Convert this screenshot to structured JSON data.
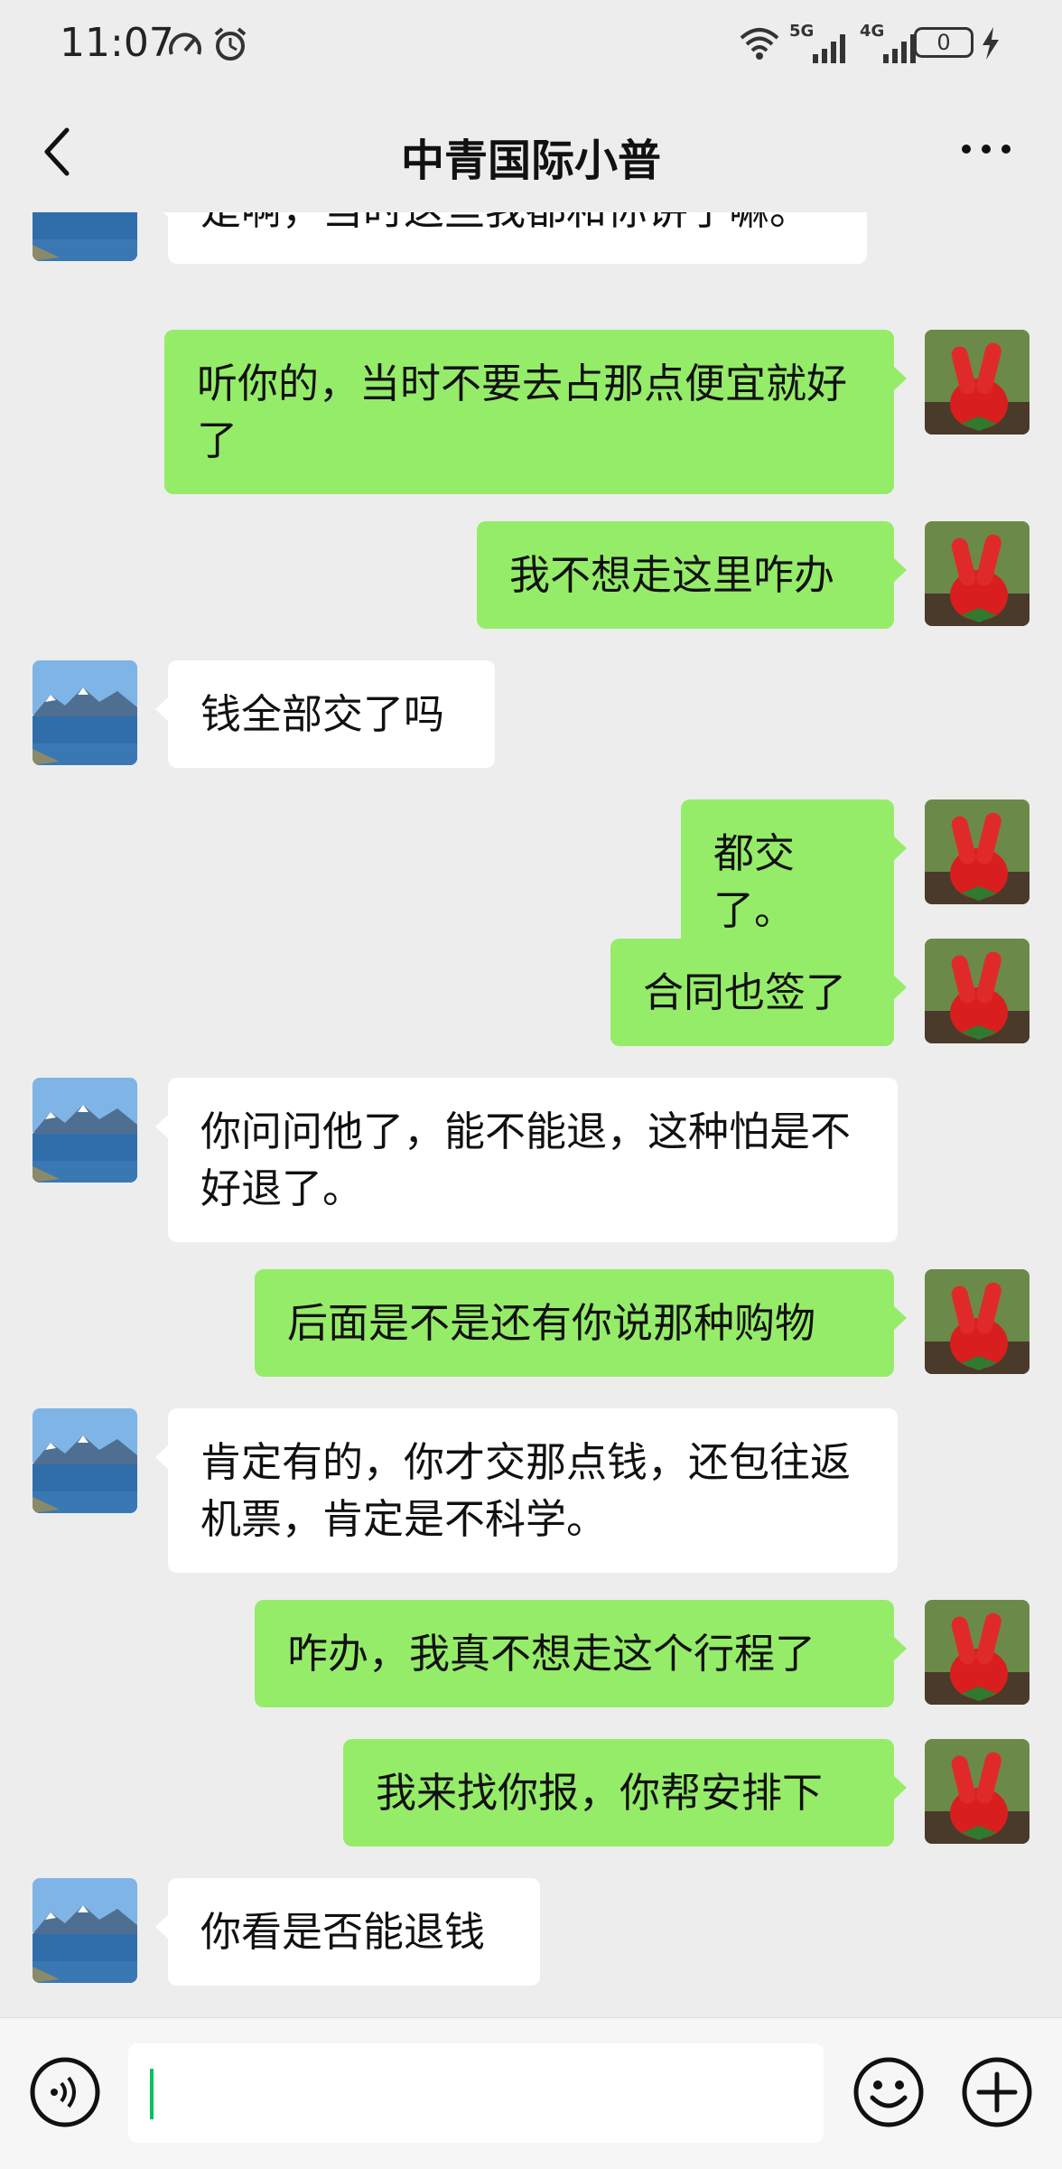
{
  "status_bar": {
    "time": "11:07",
    "icons": [
      "speedometer-icon",
      "alarm-icon",
      "wifi-icon",
      "signal-5g-icon",
      "signal-4g-icon",
      "battery-icon",
      "charging-icon"
    ],
    "network_5g": "5G",
    "network_4g": "4G",
    "battery_level": "0"
  },
  "header": {
    "title": "中青国际小普",
    "back_icon": "chevron-left-icon",
    "more_icon": "more-icon"
  },
  "messages": [
    {
      "side": "in",
      "text": "是啊，当时这些我都和你讲了嘛。"
    },
    {
      "side": "out",
      "text": "听你的，当时不要去占那点便宜就好了"
    },
    {
      "side": "out",
      "text": "我不想走这里咋办"
    },
    {
      "side": "in",
      "text": "钱全部交了吗"
    },
    {
      "side": "out",
      "text": "都交了。"
    },
    {
      "side": "out",
      "text": "合同也签了"
    },
    {
      "side": "in",
      "text": "你问问他了，能不能退，这种怕是不好退了。"
    },
    {
      "side": "out",
      "text": "后面是不是还有你说那种购物"
    },
    {
      "side": "in",
      "text": "肯定有的，你才交那点钱，还包往返机票，肯定是不科学。"
    },
    {
      "side": "out",
      "text": "咋办，我真不想走这个行程了"
    },
    {
      "side": "out",
      "text": "我来找你报，你帮安排下"
    },
    {
      "side": "in",
      "text": "你看是否能退钱"
    }
  ],
  "input_bar": {
    "voice_icon": "voice-icon",
    "text_value": "",
    "emoji_icon": "emoji-icon",
    "plus_icon": "plus-icon"
  },
  "colors": {
    "background": "#ededed",
    "incoming_bubble": "#ffffff",
    "outgoing_bubble": "#95ec69",
    "caret": "#07c160"
  }
}
